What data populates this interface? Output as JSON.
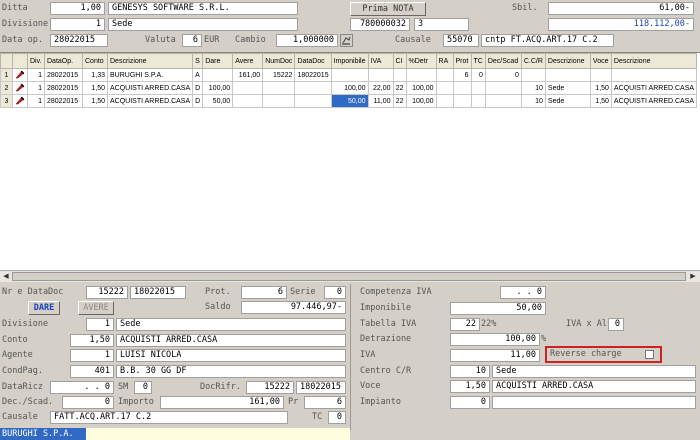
{
  "header": {
    "ditta_label": "Ditta",
    "ditta_num": "1,00",
    "ditta_name": "GENESYS SOFTWARE S.R.L.",
    "prima_nota_button": "Prima NOTA",
    "sbil_label": "Sbil.",
    "sbil_value": "61,00-",
    "divisione_label": "Divisione",
    "divisione_num": "1",
    "divisione_name": "Sede",
    "doc_num": "780000032",
    "doc_count": "3",
    "total_value": "118.112,00-",
    "data_op_label": "Data op.",
    "data_op_value": "28022015",
    "valuta_label": "Valuta",
    "valuta_num": "6",
    "valuta_code": "EUR",
    "cambio_label": "Cambio",
    "cambio_value": "1,000000",
    "causale_label": "Causale",
    "causale_code": "55070",
    "causale_desc": "cntp FT.ACQ.ART.17 C.2"
  },
  "grid": {
    "columns": [
      "",
      "Div.",
      "DataOp.",
      "Conto",
      "Descrizione",
      "S",
      "Dare",
      "Avere",
      "NumDoc",
      "DataDoc",
      "Imponibile",
      "IVA",
      "CI",
      "%Detr",
      "RA",
      "Prot",
      "TC",
      "Dec/Scad",
      "C.C/R",
      "Descrizione",
      "Voce",
      "Descrizione"
    ],
    "rows": [
      [
        "1",
        "1",
        "28022015",
        "1,33",
        "BURUGHI S.P.A.",
        "A",
        "",
        "161,00",
        "15222",
        "18022015",
        "",
        "",
        "",
        "",
        "",
        "6",
        "0",
        "0",
        "",
        "",
        "",
        ""
      ],
      [
        "2",
        "1",
        "28022015",
        "1,50",
        "ACQUISTI ARRED.CASA",
        "D",
        "100,00",
        "",
        "",
        "",
        "100,00",
        "22,00",
        "22",
        "100,00",
        "",
        "",
        "",
        "",
        "10",
        "Sede",
        "1,50",
        "ACQUISTI ARRED.CASA"
      ],
      [
        "3",
        "1",
        "28022015",
        "1,50",
        "ACQUISTI ARRED.CASA",
        "D",
        "50,00",
        "",
        "",
        "",
        "50,00",
        "11,00",
        "22",
        "100,00",
        "",
        "",
        "",
        "",
        "10",
        "Sede",
        "1,50",
        "ACQUISTI ARRED.CASA"
      ]
    ]
  },
  "detail_left": {
    "nr_datadoc_label": "Nr e DataDoc",
    "nr_doc": "15222",
    "data_doc": "18022015",
    "prot_label": "Prot.",
    "prot_value": "6",
    "serie_label": "Serie",
    "serie_value": "0",
    "dare_button": "DARE",
    "avere_button": "AVERE",
    "saldo_label": "Saldo",
    "saldo_value": "97.446,97-",
    "divisione_label": "Divisione",
    "divisione_num": "1",
    "divisione_name": "Sede",
    "conto_label": "Conto",
    "conto_num": "1,50",
    "conto_name": "ACQUISTI ARRED.CASA",
    "agente_label": "Agente",
    "agente_num": "1",
    "agente_name": "LUISI NICOLA",
    "condpag_label": "CondPag.",
    "condpag_num": "401",
    "condpag_name": "B.B. 30 GG DF",
    "dataricz_label": "DataRicz",
    "dataricz_value": ". . 0",
    "sm_label": "SM",
    "sm_value": "0",
    "docrifr_label": "DocRifr.",
    "docrifr_num": "15222",
    "docrifr_date": "18022015",
    "decscad_label": "Dec./Scad.",
    "decscad_value": "0",
    "importo_label": "Importo",
    "importo_value": "161,00",
    "pr_label": "Pr",
    "pr_value": "6",
    "causale_label": "Causale",
    "causale_value": "FATT.ACQ.ART.17 C.2",
    "tc_label": "TC",
    "tc_value": "0"
  },
  "detail_right": {
    "competenza_label": "Competenza IVA",
    "competenza_value": ". . 0",
    "imponibile_label": "Imponibile",
    "imponibile_value": "50,00",
    "tabella_label": "Tabella IVA",
    "tabella_code": "22",
    "tabella_pct": "22%",
    "iva_al_label": "IVA x Al",
    "iva_al_value": "0",
    "detrazione_label": "Detrazione",
    "detrazione_value": "100,00",
    "detrazione_unit": "%",
    "iva_label": "IVA",
    "iva_value": "11,00",
    "reverse_label": "Reverse charge",
    "centro_label": "Centro C/R",
    "centro_num": "10",
    "centro_name": "Sede",
    "voce_label": "Voce",
    "voce_num": "1,50",
    "voce_name": "ACQUISTI ARRED.CASA",
    "impianto_label": "Impianto",
    "impianto_value": "0"
  },
  "status": {
    "text": "BURUGHI S.P.A."
  }
}
